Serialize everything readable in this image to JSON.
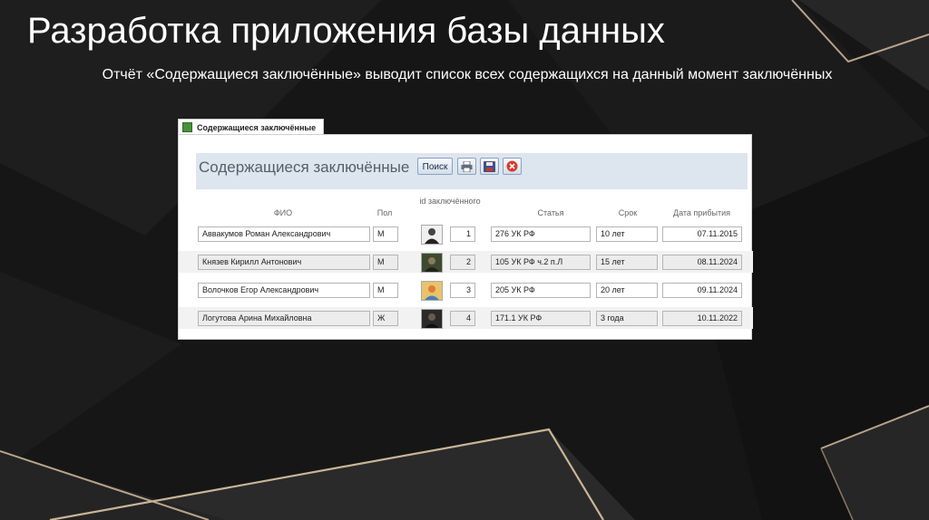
{
  "slide": {
    "title": "Разработка приложения базы данных",
    "subtitle": "Отчёт «Содержащиеся заключённые» выводит список всех содержащихся на данный момент заключённых"
  },
  "access": {
    "tab_label": "Содержащиеся заключённые",
    "report_title": "Содержащиеся заключённые",
    "search_button": "Поиск",
    "icon_buttons": [
      "print-icon",
      "save-icon",
      "close-icon"
    ],
    "columns": {
      "fio": "ФИО",
      "sex": "Пол",
      "id": "id заключённого",
      "article": "Статья",
      "term": "Срок",
      "arrival": "Дата прибытия"
    },
    "rows": [
      {
        "fio": "Аввакумов Роман Александрович",
        "sex": "М",
        "id": "1",
        "article": "276 УК РФ",
        "term": "10 лет",
        "arrival": "07.11.2015"
      },
      {
        "fio": "Князев Кирилл Антонович",
        "sex": "М",
        "id": "2",
        "article": "105 УК РФ ч.2 п.Л",
        "term": "15 лет",
        "arrival": "08.11.2024"
      },
      {
        "fio": "Волочков Егор Александрович",
        "sex": "М",
        "id": "3",
        "article": "205 УК РФ",
        "term": "20 лет",
        "arrival": "09.11.2024"
      },
      {
        "fio": "Логутова Арина Михайловна",
        "sex": "Ж",
        "id": "4",
        "article": "171.1 УК РФ",
        "term": "3 года",
        "arrival": "10.11.2022"
      }
    ]
  }
}
